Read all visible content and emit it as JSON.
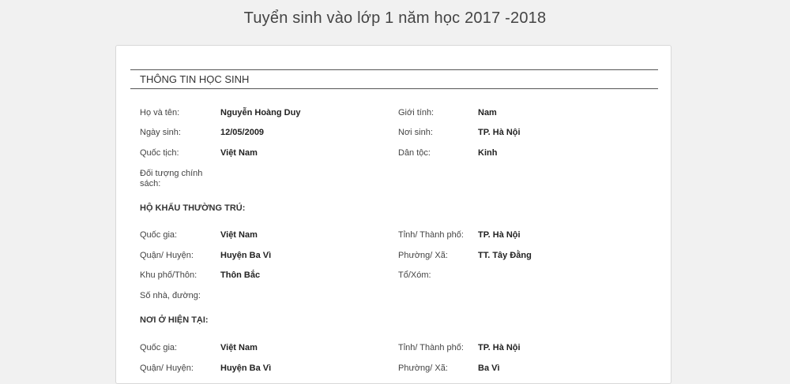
{
  "page": {
    "title": "Tuyển sinh vào lớp 1 năm học 2017 -2018"
  },
  "student": {
    "section_title": "THÔNG TIN HỌC SINH",
    "full_name": {
      "label": "Họ và tên:",
      "value": "Nguyễn Hoàng Duy"
    },
    "gender": {
      "label": "Giới tính:",
      "value": "Nam"
    },
    "dob": {
      "label": "Ngày sinh:",
      "value": "12/05/2009"
    },
    "birthplace": {
      "label": "Nơi sinh:",
      "value": "TP. Hà Nội"
    },
    "nationality": {
      "label": "Quốc tịch:",
      "value": "Việt Nam"
    },
    "ethnicity": {
      "label": "Dân tộc:",
      "value": "Kinh"
    },
    "policy": {
      "label_line1": "Đối tượng chính",
      "label_line2": "sách:"
    }
  },
  "permanent": {
    "heading": "HỘ KHẨU THƯỜNG TRÚ:",
    "country": {
      "label": "Quốc gia:",
      "value": "Việt Nam"
    },
    "province": {
      "label": "Tỉnh/ Thành phố:",
      "value": "TP. Hà Nội"
    },
    "district": {
      "label": "Quận/ Huyện:",
      "value": "Huyện Ba Vì"
    },
    "ward": {
      "label": "Phường/ Xã:",
      "value": "TT. Tây Đằng"
    },
    "area": {
      "label": "Khu phố/Thôn:",
      "value": "Thôn Bắc"
    },
    "group": {
      "label": "Tổ/Xóm:"
    },
    "street": {
      "label": "Số nhà, đường:"
    }
  },
  "current": {
    "heading": "NƠI Ở HIỆN TẠI:",
    "country": {
      "label": "Quốc gia:",
      "value": "Việt Nam"
    },
    "province": {
      "label": "Tỉnh/ Thành phố:",
      "value": "TP. Hà Nội"
    },
    "district": {
      "label": "Quận/ Huyện:",
      "value": "Huyện Ba Vì"
    },
    "ward": {
      "label": "Phường/ Xã:",
      "value": "Ba Vì"
    }
  }
}
